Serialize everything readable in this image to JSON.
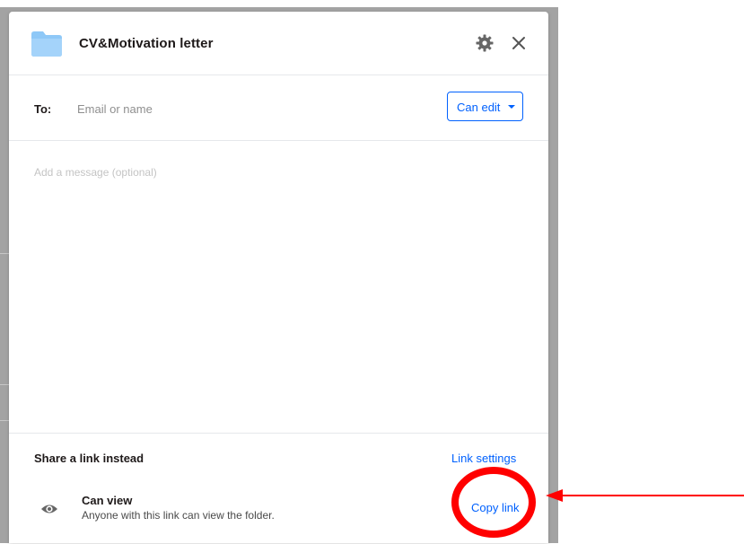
{
  "dialog": {
    "title": "CV&Motivation letter",
    "folder_color": "#8ec8f7",
    "icons": {
      "folder": "folder-icon",
      "settings": "gear-icon",
      "close": "close-icon"
    }
  },
  "recipients": {
    "label": "To:",
    "placeholder": "Email or name",
    "value": "",
    "permission": {
      "selected": "Can edit",
      "dropdown_icon": "caret-down-icon"
    }
  },
  "message": {
    "placeholder": "Add a message (optional)",
    "value": ""
  },
  "share_link": {
    "heading": "Share a link instead",
    "settings_link": "Link settings",
    "permission_title": "Can view",
    "permission_description": "Anyone with this link can view the folder.",
    "permission_icon": "eye-icon",
    "copy_link": "Copy link"
  },
  "colors": {
    "accent": "#0061fe",
    "annotation": "#ff0000",
    "backdrop": "#a3a3a3"
  }
}
